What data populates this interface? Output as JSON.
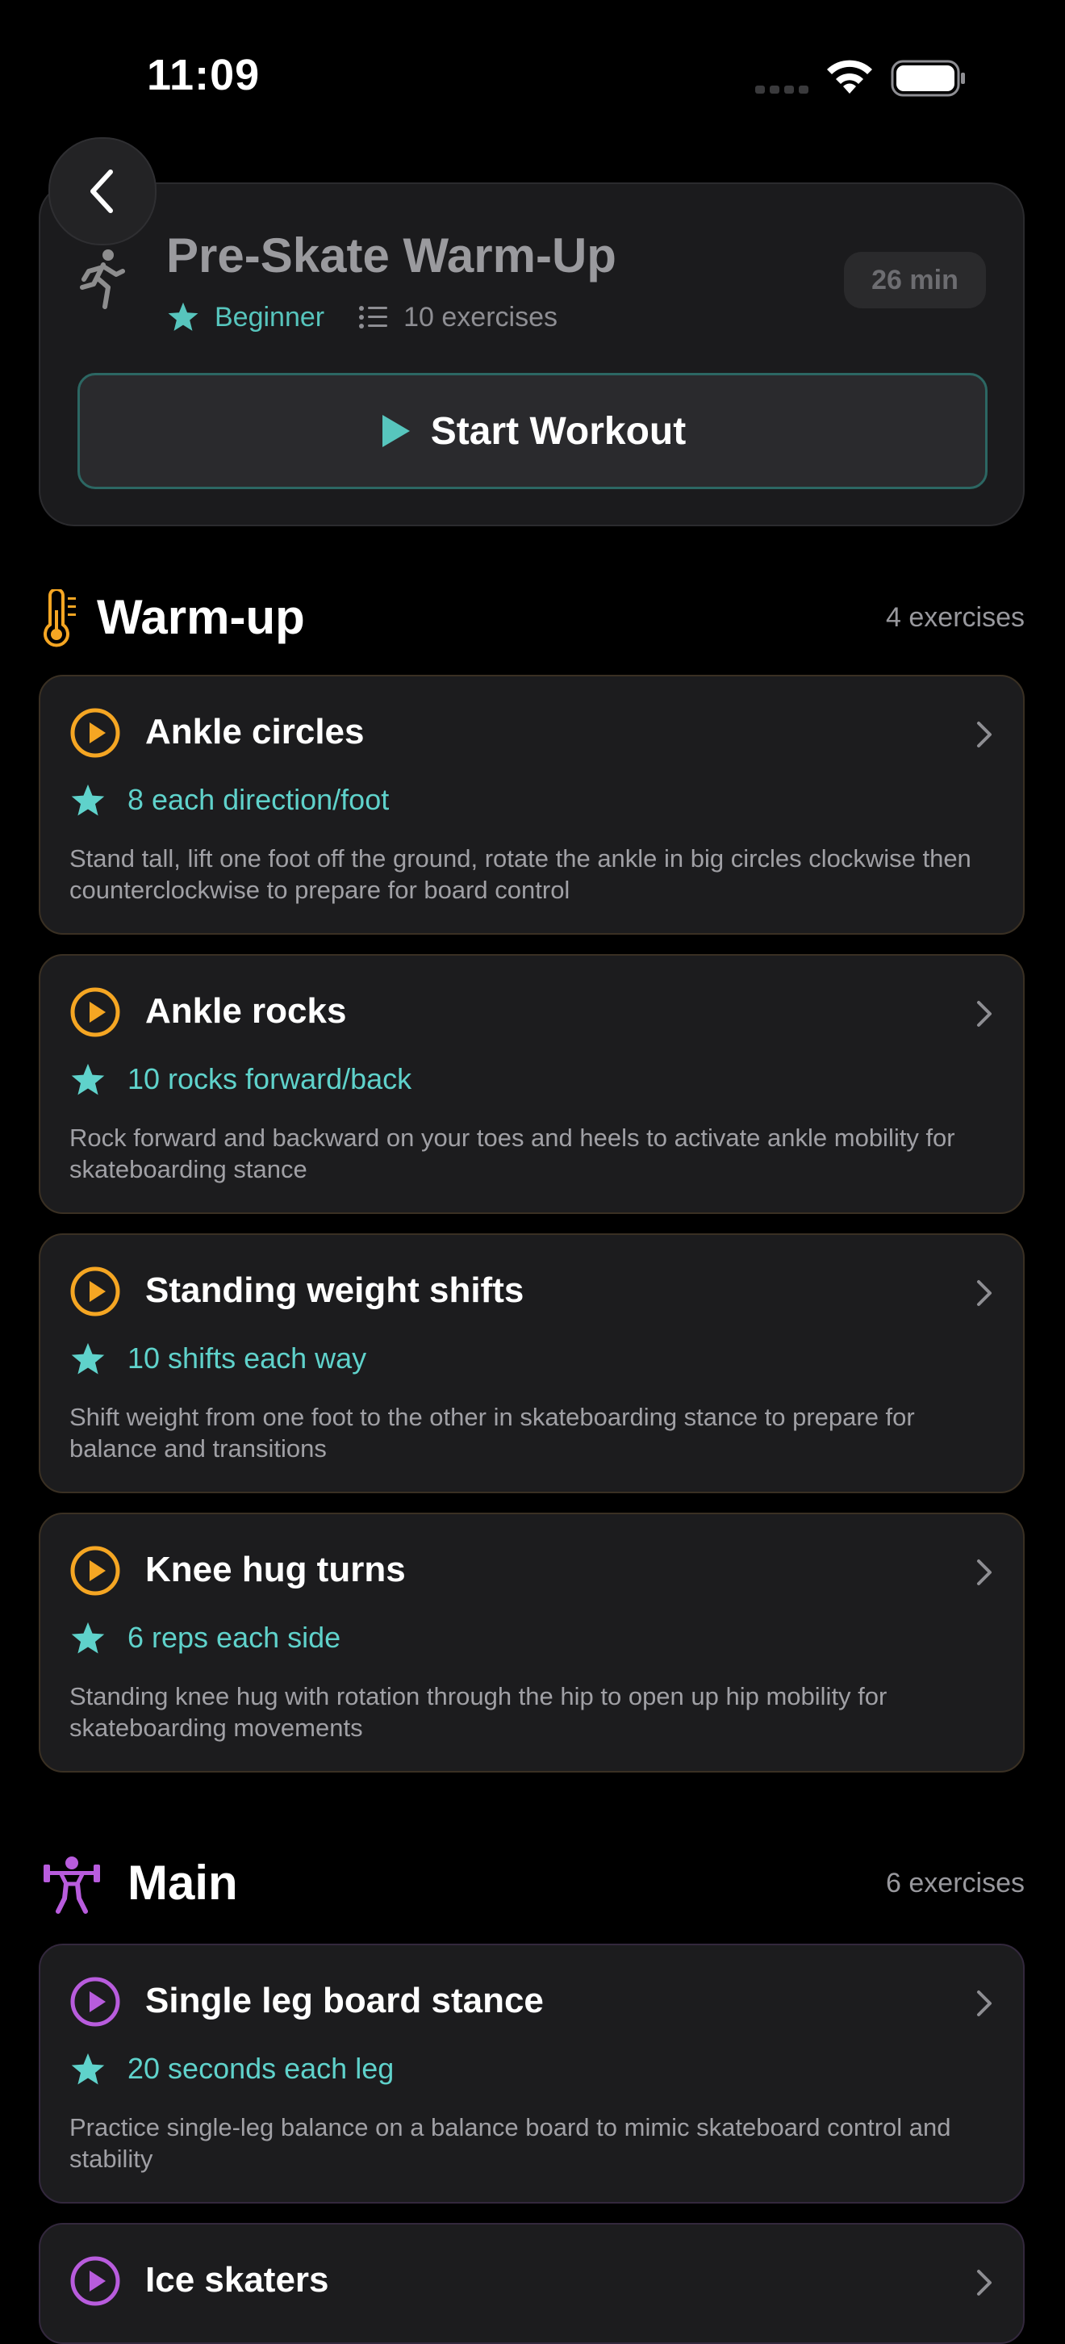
{
  "status": {
    "time": "11:09"
  },
  "workout": {
    "title": "Pre-Skate Warm-Up",
    "level": "Beginner",
    "exercise_count": "10 exercises",
    "duration": "26 min",
    "start_label": "Start Workout"
  },
  "colors": {
    "accent": "#57c5bd",
    "warmup": "#f5a623",
    "main": "#b85cdd",
    "card_bg": "#1c1c1e"
  },
  "warmup": {
    "title": "Warm-up",
    "count": "4 exercises",
    "icon": "thermometer-icon",
    "items": [
      {
        "title": "Ankle circles",
        "reps": "8 each direction/foot",
        "desc": "Stand tall, lift one foot off the ground, rotate the ankle in big circles clockwise then counterclockwise to prepare for board control"
      },
      {
        "title": "Ankle rocks",
        "reps": "10 rocks forward/back",
        "desc": "Rock forward and backward on your toes and heels to activate ankle mobility for skateboarding stance"
      },
      {
        "title": "Standing weight shifts",
        "reps": "10 shifts each way",
        "desc": "Shift weight from one foot to the other in skateboarding stance to prepare for balance and transitions"
      },
      {
        "title": "Knee hug turns",
        "reps": "6 reps each side",
        "desc": "Standing knee hug with rotation through the hip to open up hip mobility for skateboarding movements"
      }
    ]
  },
  "main": {
    "title": "Main",
    "count": "6 exercises",
    "icon": "weightlifter-icon",
    "items": [
      {
        "title": "Single leg board stance",
        "reps": "20 seconds each leg",
        "desc": "Practice single-leg balance on a balance board to mimic skateboard control and stability"
      },
      {
        "title": "Ice skaters",
        "reps": "",
        "desc": ""
      }
    ]
  }
}
